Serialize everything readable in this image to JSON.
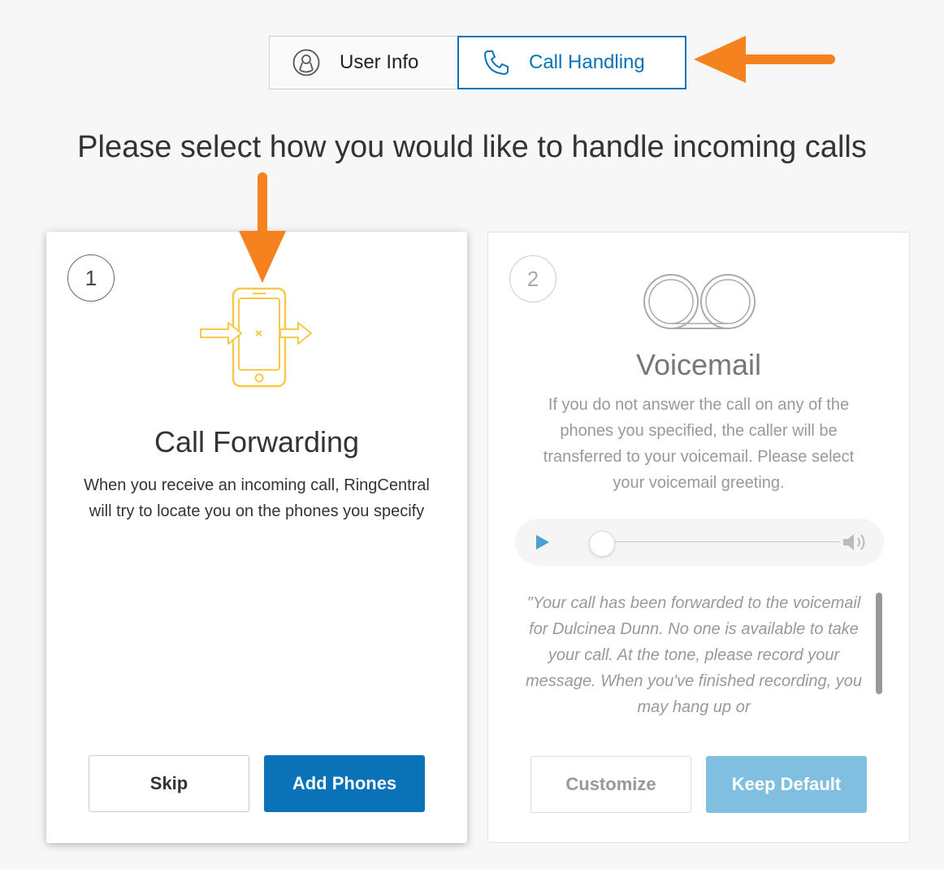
{
  "tabs": [
    {
      "label": "User Info",
      "icon": "user-icon",
      "active": false
    },
    {
      "label": "Call Handling",
      "icon": "phone-icon",
      "active": true
    }
  ],
  "heading": "Please select how you would like to handle incoming calls",
  "cards": {
    "forwarding": {
      "number": "1",
      "icon": "phone-forward-icon",
      "title": "Call Forwarding",
      "description": "When you receive an incoming call, RingCentral will try to locate you on the phones you specify",
      "buttons": {
        "skip": "Skip",
        "add": "Add Phones"
      }
    },
    "voicemail": {
      "number": "2",
      "icon": "voicemail-icon",
      "title": "Voicemail",
      "description": "If you do not answer the call on any of the phones you specified, the caller will be transferred to your voicemail. Please select your voicemail greeting.",
      "greeting": "\"Your call has been forwarded to the voicemail for Dulcinea Dunn. No one is available to take your call. At the tone, please record your message. When you've finished recording, you may hang up or",
      "buttons": {
        "customize": "Customize",
        "keep": "Keep Default"
      }
    }
  },
  "colors": {
    "accent": "#0a73b7",
    "annotation_arrow": "#f5821f",
    "icon_yellow": "#f7c948"
  }
}
